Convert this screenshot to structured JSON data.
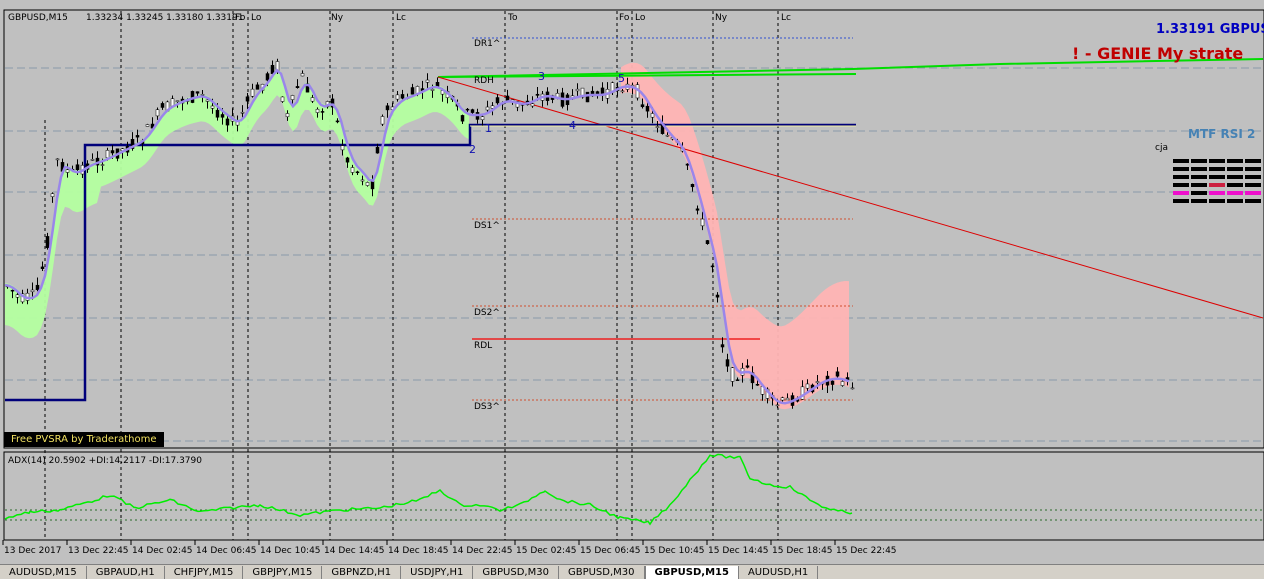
{
  "header": {
    "symbol": "GBPUSD,M15",
    "ohlc": "1.33234 1.33245 1.33180 1.33191"
  },
  "current_price_text": "1.33191 GBPUS",
  "indicator_title": "! - GENIE My strate",
  "mtf": {
    "title": "MTF RSI 2",
    "label": "cja"
  },
  "pvsra_label": "Free PVSRA by Traderathome",
  "adx": {
    "label": "ADX(14) 20.5902 +DI:14.2117 -DI:17.3790"
  },
  "session_labels": [
    "Fo",
    "Lo",
    "Ny",
    "Lc",
    "To",
    "Fo",
    "Lo",
    "Ny",
    "Lc"
  ],
  "pivot_labels": [
    "DR1^",
    "RDH",
    "DS1^",
    "DS2^",
    "RDL",
    "DS3^"
  ],
  "wave_labels": [
    "1",
    "2",
    "3",
    "4",
    "5"
  ],
  "x_axis_labels": [
    "13 Dec 2017",
    "13 Dec 22:45",
    "14 Dec 02:45",
    "14 Dec 06:45",
    "14 Dec 10:45",
    "14 Dec 14:45",
    "14 Dec 18:45",
    "14 Dec 22:45",
    "15 Dec 02:45",
    "15 Dec 06:45",
    "15 Dec 10:45",
    "15 Dec 14:45",
    "15 Dec 18:45",
    "15 Dec 22:45"
  ],
  "tabs": [
    {
      "label": "AUDUSD,M15",
      "active": false
    },
    {
      "label": "GBPAUD,H1",
      "active": false
    },
    {
      "label": "CHFJPY,M15",
      "active": false
    },
    {
      "label": "GBPJPY,M15",
      "active": false
    },
    {
      "label": "GBPNZD,H1",
      "active": false
    },
    {
      "label": "USDJPY,H1",
      "active": false
    },
    {
      "label": "GBPUSD,M30",
      "active": false
    },
    {
      "label": "GBPUSD,M30",
      "active": false
    },
    {
      "label": "GBPUSD,M15",
      "active": true
    },
    {
      "label": "AUDUSD,H1",
      "active": false
    }
  ],
  "colors": {
    "background": "#c0c0c0",
    "bull_band": "#b4ffa0",
    "bear_band": "#ffb4b4",
    "ma_line": "#9a86ea",
    "pivot_line": "#00dd00",
    "trend_line": "#dd0000",
    "step_line": "#00007a",
    "adx_line": "#00ee00",
    "mtf_black": "#000000",
    "mtf_red": "#cc2040",
    "mtf_magenta": "#ee10cc"
  },
  "mtf_rows": [
    [
      "black",
      "black",
      "black",
      "black",
      "black"
    ],
    [
      "black",
      "black",
      "black",
      "black",
      "black"
    ],
    [
      "black",
      "black",
      "black",
      "black",
      "black"
    ],
    [
      "black",
      "black",
      "red",
      "black",
      "black"
    ],
    [
      "magenta",
      "black",
      "magenta",
      "magenta",
      "magenta"
    ],
    [
      "black",
      "black",
      "black",
      "black",
      "black"
    ]
  ]
}
